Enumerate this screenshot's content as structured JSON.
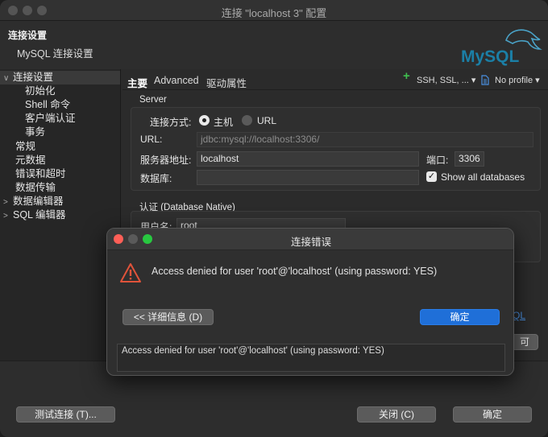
{
  "window": {
    "title": "连接 \"localhost 3\" 配置"
  },
  "header": {
    "title": "连接设置",
    "subtitle": "MySQL 连接设置",
    "logo_text": "MySQL"
  },
  "tree": {
    "items": [
      {
        "label": "连接设置",
        "caret": "∨"
      },
      {
        "label": "初始化"
      },
      {
        "label": "Shell 命令"
      },
      {
        "label": "客户端认证"
      },
      {
        "label": "事务"
      },
      {
        "label": "常规"
      },
      {
        "label": "元数据"
      },
      {
        "label": "错误和超时"
      },
      {
        "label": "数据传输"
      },
      {
        "label": "数据编辑器",
        "caret": ">"
      },
      {
        "label": "SQL 编辑器",
        "caret": ">"
      }
    ]
  },
  "tabs": {
    "items": [
      "主要",
      "Advanced",
      "驱动属性"
    ],
    "ssh_label": "SSH, SSL, ...",
    "profile_label": "No profile"
  },
  "server": {
    "group_label": "Server",
    "conn_method_label": "连接方式:",
    "host_option": "主机",
    "url_option": "URL",
    "url_label": "URL:",
    "url_value": "jdbc:mysql://localhost:3306/",
    "host_label": "服务器地址:",
    "host_value": "localhost",
    "port_label": "端口:",
    "port_value": "3306",
    "db_label": "数据库:",
    "db_value": "",
    "show_all_label": "Show all databases",
    "show_all_checked": true
  },
  "auth": {
    "group_label": "认证 (Database Native)",
    "user_label": "用户名:",
    "user_value": "root"
  },
  "bottom": {
    "test_button": "测试连接 (T)...",
    "close_button": "关闭 (C)",
    "ok_button": "确定"
  },
  "behind": {
    "link_fragment": "QL",
    "button_fragment": "可"
  },
  "dialog": {
    "title": "连接错误",
    "message": "Access denied for user 'root'@'localhost' (using password: YES)",
    "details_button": "<< 详细信息 (D)",
    "ok_button": "确定",
    "detail_text": "Access denied for user 'root'@'localhost' (using password: YES)"
  },
  "colors": {
    "accent": "#1f6fd8",
    "warning": "#e0533a",
    "plus": "#3fbf4f"
  }
}
